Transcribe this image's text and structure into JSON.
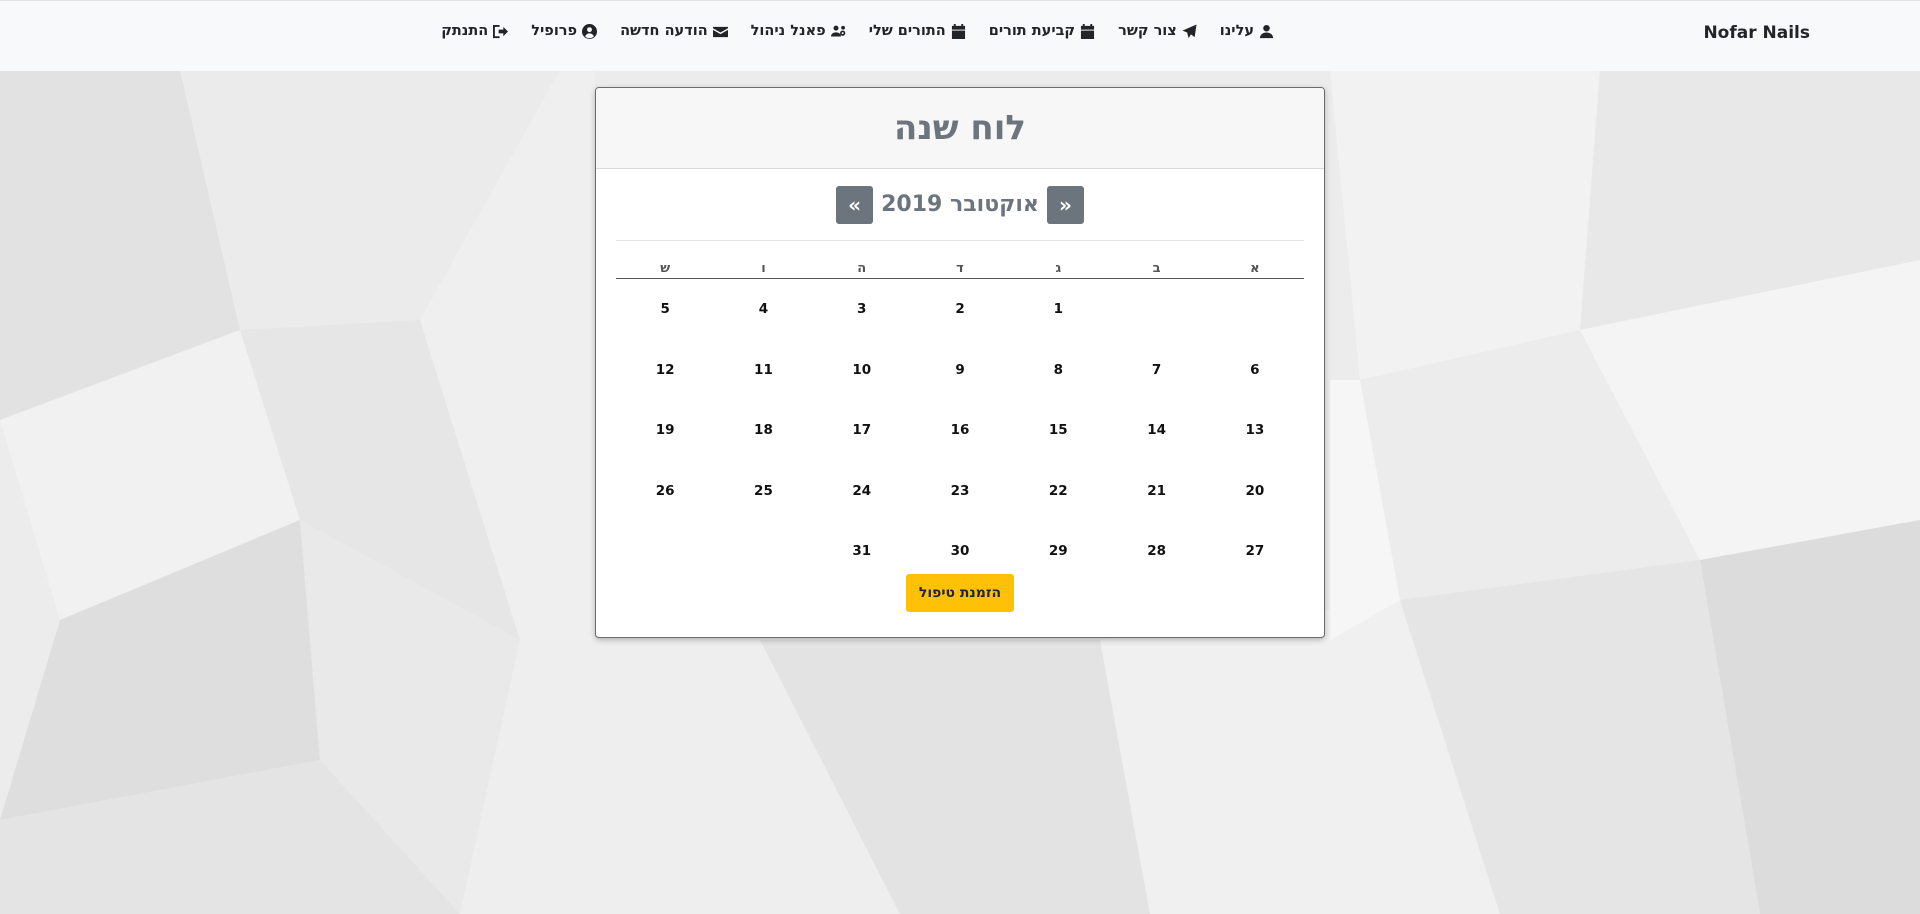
{
  "brand": {
    "name": "Nofar Nails"
  },
  "nav": {
    "items": [
      {
        "label": "עלינו",
        "icon": "user-icon"
      },
      {
        "label": "צור קשר",
        "icon": "paper-plane-icon"
      },
      {
        "label": "קביעת תורים",
        "icon": "calendar-icon"
      },
      {
        "label": "התורים שלי",
        "icon": "calendar-icon"
      },
      {
        "label": "פאנל ניהול",
        "icon": "users-cog-icon"
      },
      {
        "label": "הודעה חדשה",
        "icon": "envelope-icon"
      },
      {
        "label": "פרופיל",
        "icon": "user-circle-icon"
      },
      {
        "label": "התנתק",
        "icon": "sign-out-icon"
      }
    ]
  },
  "calendar": {
    "title": "לוח שנה",
    "month_label": "אוקטובר 2019",
    "prev_label": "«",
    "next_label": "»",
    "weekdays": [
      "א",
      "ב",
      "ג",
      "ד",
      "ה",
      "ו",
      "ש"
    ],
    "weeks": [
      [
        "",
        "",
        "1",
        "2",
        "3",
        "4",
        "5"
      ],
      [
        "6",
        "7",
        "8",
        "9",
        "10",
        "11",
        "12"
      ],
      [
        "13",
        "14",
        "15",
        "16",
        "17",
        "18",
        "19"
      ],
      [
        "20",
        "21",
        "22",
        "23",
        "24",
        "25",
        "26"
      ],
      [
        "27",
        "28",
        "29",
        "30",
        "31",
        "",
        ""
      ]
    ],
    "book_button": "הזמנת טיפול"
  },
  "colors": {
    "accent": "#ffc107",
    "secondary": "#6c757d",
    "navbar_bg": "#f8f9fa"
  }
}
